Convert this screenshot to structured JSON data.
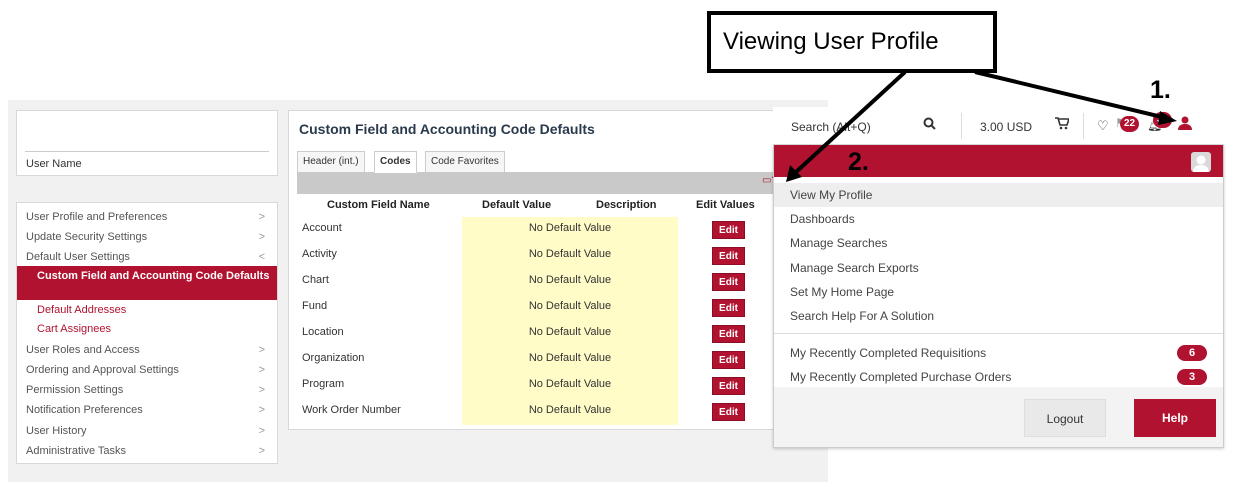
{
  "user_card": {
    "name_label": "User Name"
  },
  "side_nav": {
    "items": [
      {
        "label": "User Profile and Preferences",
        "chevron": ">"
      },
      {
        "label": "Update Security Settings",
        "chevron": ">"
      },
      {
        "label": "Default User Settings",
        "chevron": "<"
      },
      {
        "label": "Custom Field and Accounting Code Defaults"
      },
      {
        "label": "Default Addresses"
      },
      {
        "label": "Cart Assignees"
      },
      {
        "label": "User Roles and Access",
        "chevron": ">"
      },
      {
        "label": "Ordering and Approval Settings",
        "chevron": ">"
      },
      {
        "label": "Permission Settings",
        "chevron": ">"
      },
      {
        "label": "Notification Preferences",
        "chevron": ">"
      },
      {
        "label": "User History",
        "chevron": ">"
      },
      {
        "label": "Administrative Tasks",
        "chevron": ">"
      }
    ]
  },
  "main": {
    "title": "Custom Field and Accounting Code Defaults",
    "tabs": [
      "Header (int.)",
      "Codes",
      "Code Favorites"
    ],
    "help_glyph": "?",
    "columns": [
      "Custom Field Name",
      "Default Value",
      "Description",
      "Edit Values"
    ],
    "rows": [
      {
        "name": "Account",
        "default": "No Default Value",
        "edit": "Edit"
      },
      {
        "name": "Activity",
        "default": "No Default Value",
        "edit": "Edit"
      },
      {
        "name": "Chart",
        "default": "No Default Value",
        "edit": "Edit"
      },
      {
        "name": "Fund",
        "default": "No Default Value",
        "edit": "Edit"
      },
      {
        "name": "Location",
        "default": "No Default Value",
        "edit": "Edit"
      },
      {
        "name": "Organization",
        "default": "No Default Value",
        "edit": "Edit"
      },
      {
        "name": "Program",
        "default": "No Default Value",
        "edit": "Edit"
      },
      {
        "name": "Work Order Number",
        "default": "No Default Value",
        "edit": "Edit"
      }
    ]
  },
  "topbar": {
    "search_placeholder": "Search (Alt+Q)",
    "cart_amount": "3.00 USD",
    "favorites_badge": "22",
    "notifications_badge": "39"
  },
  "menu": {
    "items": [
      "View My Profile",
      "Dashboards",
      "Manage Searches",
      "Manage Search Exports",
      "Set My Home Page",
      "Search Help For A Solution"
    ],
    "recent": [
      {
        "label": "My Recently Completed Requisitions",
        "count": "6"
      },
      {
        "label": "My Recently Completed Purchase Orders",
        "count": "3"
      }
    ],
    "logout": "Logout",
    "help": "Help"
  },
  "annotations": {
    "callout": "Viewing User Profile",
    "step1": "1.",
    "step2": "2."
  },
  "colors": {
    "accent": "#b0122f",
    "default_value_bg": "#fffcc7"
  }
}
